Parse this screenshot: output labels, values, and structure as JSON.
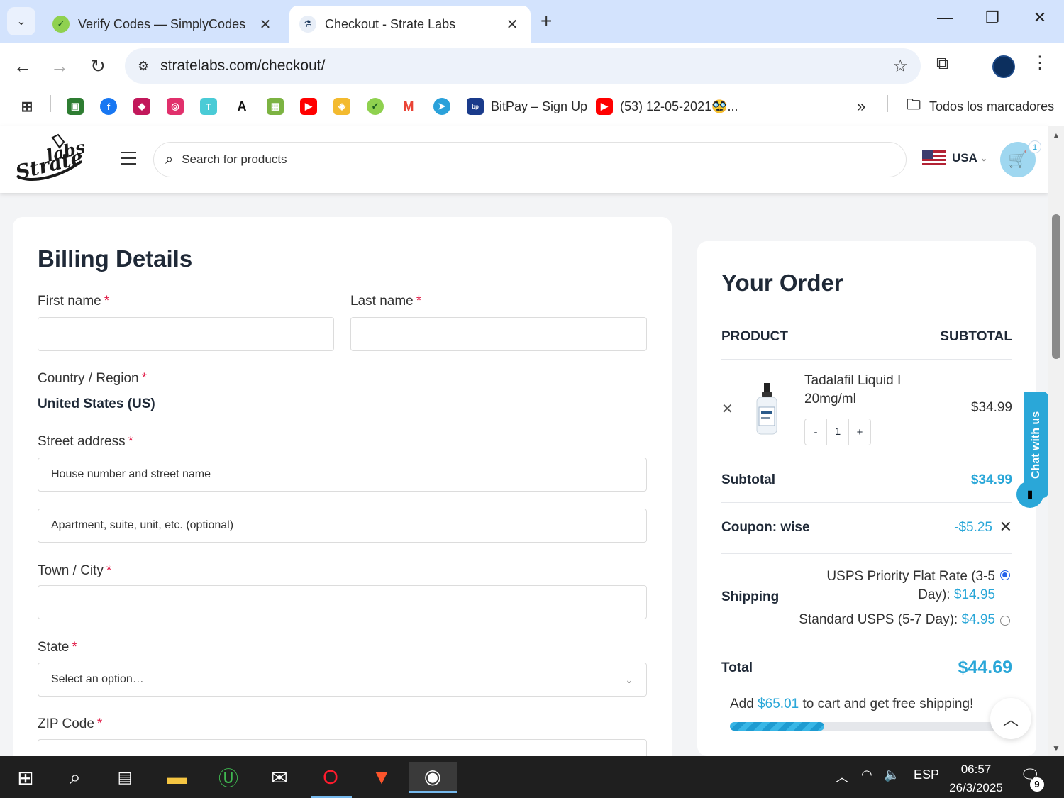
{
  "browser": {
    "tabs": [
      {
        "title": "Verify Codes — SimplyCodes",
        "active": false
      },
      {
        "title": "Checkout - Strate Labs",
        "active": true
      }
    ],
    "url": "stratelabs.com/checkout/",
    "bookmarks": [
      {
        "label": "BitPay – Sign Up"
      },
      {
        "label": "(53) 12-05-2021🥸..."
      }
    ],
    "all_bookmarks_label": "Todos los marcadores",
    "more_bookmarks": "»"
  },
  "header": {
    "search_placeholder": "Search for products",
    "country": "USA",
    "cart_count": "1"
  },
  "billing": {
    "title": "Billing Details",
    "first_name_label": "First name",
    "last_name_label": "Last name",
    "country_label": "Country / Region",
    "country_value": "United States (US)",
    "street_label": "Street address",
    "street_placeholder": "House number and street name",
    "apt_placeholder": "Apartment, suite, unit, etc. (optional)",
    "city_label": "Town / City",
    "state_label": "State",
    "state_placeholder": "Select an option…",
    "zip_label": "ZIP Code",
    "required_mark": "*"
  },
  "order": {
    "title": "Your Order",
    "product_header": "PRODUCT",
    "subtotal_header": "SUBTOTAL",
    "item": {
      "name_line1": "Tadalafil Liquid I",
      "name_line2": "20mg/ml",
      "price": "$34.99",
      "qty": "1",
      "minus": "-",
      "plus": "+"
    },
    "subtotal_label": "Subtotal",
    "subtotal_value": "$34.99",
    "coupon_label": "Coupon: wise",
    "coupon_value": "-$5.25",
    "shipping_label": "Shipping",
    "shipping_opt1_text_line1": "USPS Priority Flat Rate (3-5",
    "shipping_opt1_text_line2": "Day):",
    "shipping_opt1_price": "$14.95",
    "shipping_opt2_text": "Standard USPS (5-7 Day):",
    "shipping_opt2_price": "$4.95",
    "total_label": "Total",
    "total_value": "$44.69",
    "free_ship_prefix": "Add",
    "free_ship_amount": "$65.01",
    "free_ship_suffix": "to cart and get free shipping!",
    "free_ship_progress": 0.35
  },
  "chat": {
    "label": "Chat with us"
  },
  "taskbar": {
    "language": "ESP",
    "time": "06:57",
    "date": "26/3/2025",
    "notifications": "9"
  },
  "colors": {
    "accent": "#2aa7d8",
    "required": "#e11d48"
  }
}
